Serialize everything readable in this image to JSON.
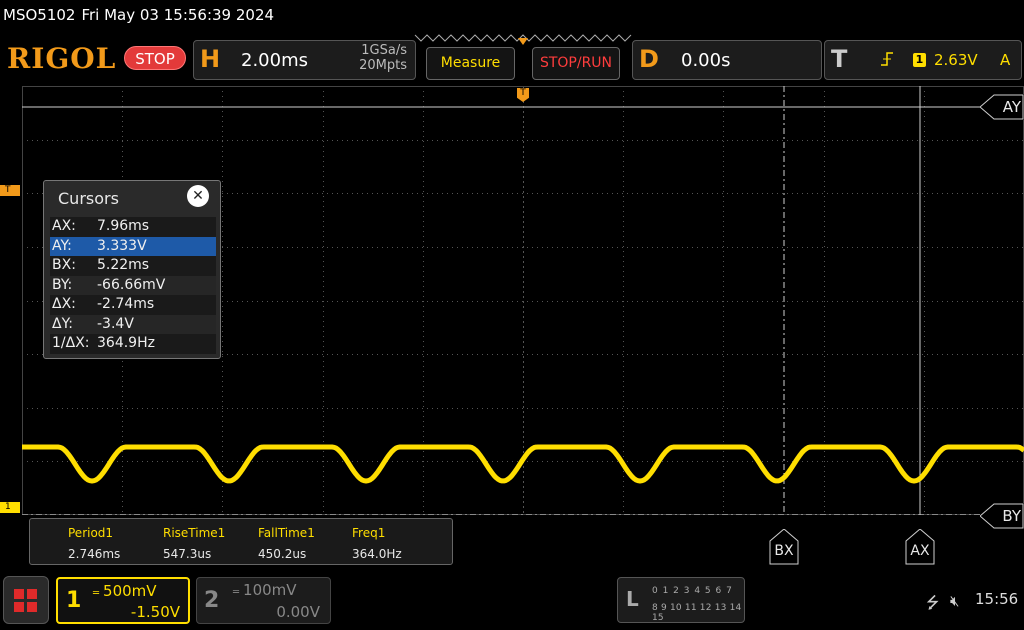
{
  "title_bar": {
    "model": "MSO5102",
    "datetime": "Fri May 03 15:56:39 2024"
  },
  "toolbar": {
    "logo": "RIGOL",
    "run_state": "STOP",
    "horizontal": {
      "key": "H",
      "timebase": "2.00ms",
      "sample_rate": "1GSa/s",
      "memory_depth": "20Mpts"
    },
    "measure_label": "Measure",
    "stop_run_label": "STOP/RUN",
    "delay": {
      "key": "D",
      "value": "0.00s"
    },
    "trigger": {
      "key": "T",
      "edge_icon": "rising-edge-icon",
      "channel": "1",
      "level": "2.63V",
      "mode": "A"
    }
  },
  "markers": {
    "trigger_level": "T",
    "channel1": "1",
    "trigger_position": "T"
  },
  "cursors": {
    "title": "Cursors",
    "rows": [
      {
        "label": "AX:",
        "value": "7.96ms",
        "selected": false
      },
      {
        "label": "AY:",
        "value": "3.333V",
        "selected": true
      },
      {
        "label": "BX:",
        "value": "5.22ms",
        "selected": false
      },
      {
        "label": "BY:",
        "value": "-66.66mV",
        "selected": false
      },
      {
        "label": "ΔX:",
        "value": "-2.74ms",
        "selected": false
      },
      {
        "label": "ΔY:",
        "value": "-3.4V",
        "selected": false
      },
      {
        "label": "1/ΔX:",
        "value": "364.9Hz",
        "selected": false
      }
    ],
    "tags": {
      "ay": "AY",
      "by": "BY",
      "bx": "BX",
      "ax": "AX"
    }
  },
  "measurements": [
    {
      "name": "Period1",
      "value": "2.746ms"
    },
    {
      "name": "RiseTime1",
      "value": "547.3us"
    },
    {
      "name": "FallTime1",
      "value": "450.2us"
    },
    {
      "name": "Freq1",
      "value": "364.0Hz"
    }
  ],
  "channels": {
    "ch1": {
      "number": "1",
      "scale": "500mV",
      "offset": "-1.50V",
      "color": "#ffde00"
    },
    "ch2": {
      "number": "2",
      "scale": "100mV",
      "offset": "0.00V",
      "color": "#888888"
    }
  },
  "logic": {
    "key": "L",
    "row1": "0 1 2 3  4 5 6 7",
    "row2": "8 9 10 11 12 13 14 15"
  },
  "status": {
    "usb_icon": "usb-icon",
    "sound_icon": "speaker-muted-icon",
    "time": "15:56"
  },
  "colors": {
    "accent": "#f29a1a",
    "ch1": "#ffde00",
    "stop_red": "#e33a3a",
    "selection": "#1e5aa8"
  }
}
